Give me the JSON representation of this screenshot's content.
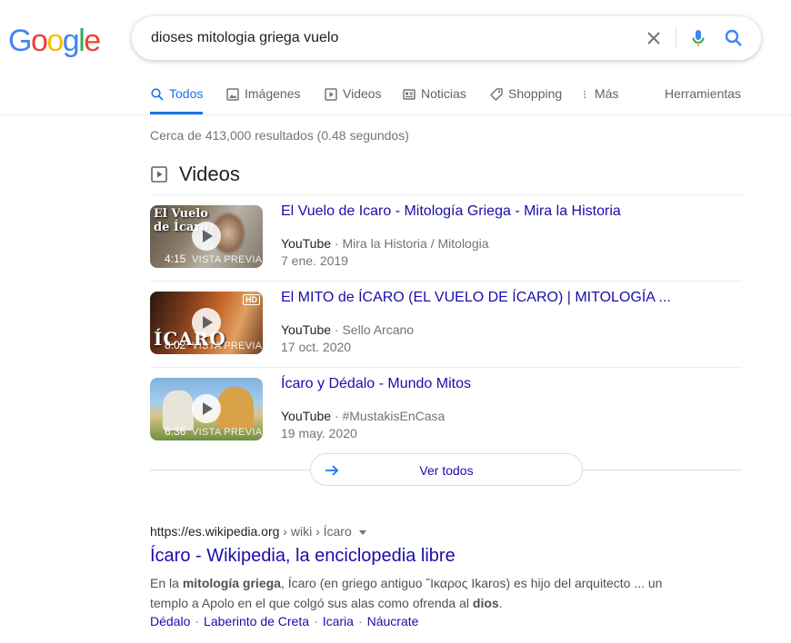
{
  "logo": {
    "letters": [
      "G",
      "o",
      "o",
      "g",
      "l",
      "e"
    ],
    "colors": [
      "#4285f4",
      "#ea4335",
      "#fbbc05",
      "#4285f4",
      "#34a853",
      "#ea4335"
    ]
  },
  "search": {
    "query": "dioses mitologia griega vuelo",
    "clear_icon": "close-icon",
    "mic_icon": "microphone-icon",
    "search_icon": "search-icon"
  },
  "tabs": [
    {
      "label": "Todos",
      "icon": "search-icon",
      "active": true
    },
    {
      "label": "Imágenes",
      "icon": "image-icon"
    },
    {
      "label": "Videos",
      "icon": "play-icon"
    },
    {
      "label": "Noticias",
      "icon": "news-icon"
    },
    {
      "label": "Shopping",
      "icon": "tag-icon"
    },
    {
      "label": "Más",
      "icon": "more-vert-icon"
    },
    {
      "label": "Herramientas"
    }
  ],
  "stats": "Cerca de 413,000 resultados (0.48 segundos)",
  "videos": {
    "heading": "Videos",
    "items": [
      {
        "title": "El Vuelo de Icaro - Mitología Griega - Mira la Historia",
        "channel": "YouTube",
        "author": "Mira la Historia / Mitologia",
        "date": "7 ene. 2019",
        "duration": "4:15",
        "preview": "VISTA PREVIA",
        "thumb_overlay": "El Vuelo de Ícaro"
      },
      {
        "title": "El MITO de ÍCARO (EL VUELO DE ÍCARO) | MITOLOGÍA ...",
        "channel": "YouTube",
        "author": "Sello Arcano",
        "date": "17 oct. 2020",
        "duration": "8:02",
        "preview": "VISTA PREVIA",
        "thumb_overlay": "ÍCARO"
      },
      {
        "title": "Ícaro y Dédalo - Mundo Mitos",
        "channel": "YouTube",
        "author": "#MustakisEnCasa",
        "date": "19 may. 2020",
        "duration": "6:36",
        "preview": "VISTA PREVIA"
      }
    ],
    "see_all": "Ver todos"
  },
  "result": {
    "host": "https://es.wikipedia.org",
    "path": " › wiki › Ícaro",
    "title": "Ícaro - Wikipedia, la enciclopedia libre",
    "snippet_parts": [
      {
        "t": "En la "
      },
      {
        "t": "mitología griega",
        "b": true
      },
      {
        "t": ", Ícaro (en griego antiguo ῎Ικαρος Ikaros) es hijo del arquitecto ... un templo a Apolo en el que colgó sus alas como ofrenda al "
      },
      {
        "t": "dios",
        "b": true
      },
      {
        "t": "."
      }
    ],
    "sitelinks": [
      "Dédalo",
      "Laberinto de Creta",
      "Icaria",
      "Náucrate"
    ]
  }
}
